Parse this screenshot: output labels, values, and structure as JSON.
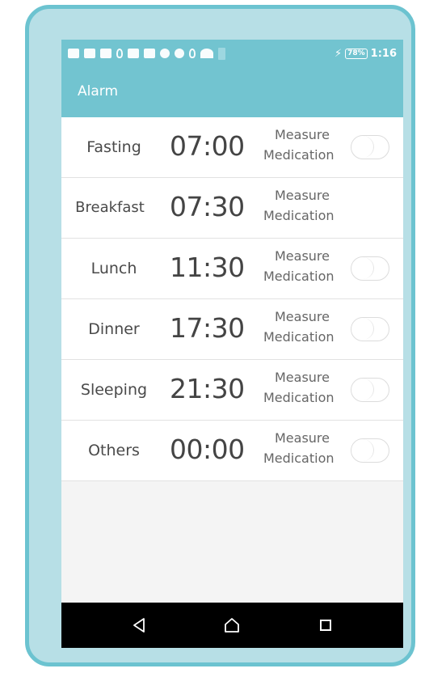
{
  "status_bar": {
    "battery_percent": "78%",
    "time": "1:16",
    "icons": [
      "message-icon",
      "media-icon",
      "gallery-icon",
      "location-icon",
      "mail-icon",
      "inbox-icon",
      "dropbox-icon",
      "settings-icon",
      "bluetooth-icon",
      "wifi-icon",
      "battery-icon"
    ]
  },
  "app_bar": {
    "title": "Alarm",
    "color": "#72c4d0"
  },
  "alarms": [
    {
      "label": "Fasting",
      "time": "07:00",
      "type_line1": "Measure",
      "type_line2": "Medication",
      "toggle": true,
      "enabled": false
    },
    {
      "label": "Breakfast",
      "time": "07:30",
      "type_line1": "Measure",
      "type_line2": "Medication",
      "toggle": false,
      "enabled": false
    },
    {
      "label": "Lunch",
      "time": "11:30",
      "type_line1": "Measure",
      "type_line2": "Medication",
      "toggle": true,
      "enabled": false
    },
    {
      "label": "Dinner",
      "time": "17:30",
      "type_line1": "Measure",
      "type_line2": "Medication",
      "toggle": true,
      "enabled": false
    },
    {
      "label": "Sleeping",
      "time": "21:30",
      "type_line1": "Measure",
      "type_line2": "Medication",
      "toggle": true,
      "enabled": false
    },
    {
      "label": "Others",
      "time": "00:00",
      "type_line1": "Measure",
      "type_line2": "Medication",
      "toggle": true,
      "enabled": false
    }
  ],
  "nav_bar": {
    "buttons": [
      "back-icon",
      "home-icon",
      "recent-apps-icon"
    ]
  },
  "colors": {
    "frame_border": "#6cc3d0",
    "frame_fill": "#b7dfe6",
    "accent": "#72c4d0"
  }
}
